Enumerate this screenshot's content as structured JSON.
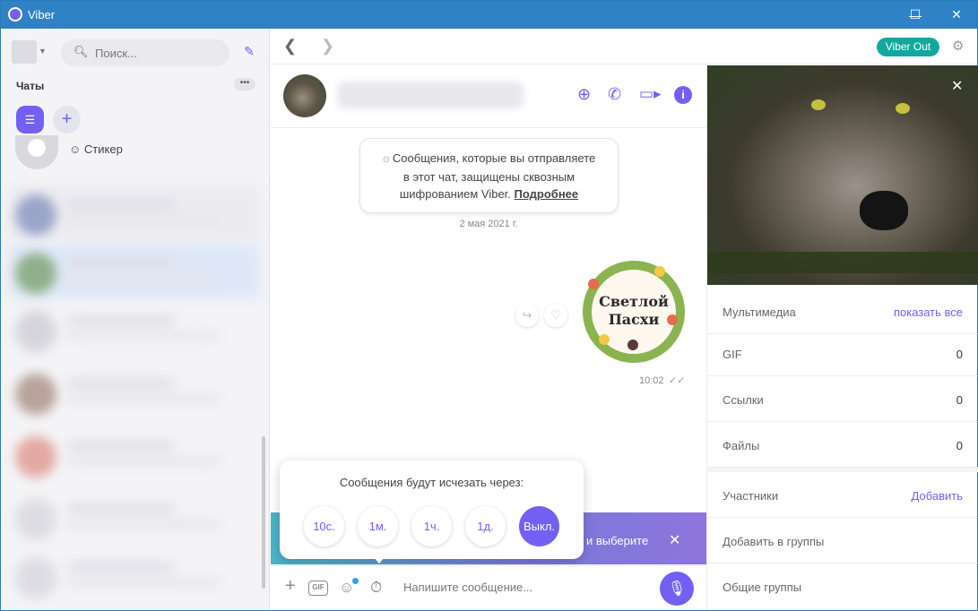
{
  "app": {
    "title": "Viber"
  },
  "window_controls": {
    "minimize": "—",
    "maximize": "☐",
    "close": "✕"
  },
  "left": {
    "search_placeholder": "Поиск...",
    "chats_label": "Чаты",
    "more": "•••",
    "sticker_row_label": "Стикер"
  },
  "topbar": {
    "viber_out": "Viber Out"
  },
  "chat": {
    "encryption_line1": "Сообщения, которые вы отправляете",
    "encryption_line2": "в этот чат, защищены сквозным",
    "encryption_line3": "шифрованием Viber.",
    "encryption_link": "Подробнее",
    "date": "2 мая 2021 г.",
    "sticker_line1": "Светлой",
    "sticker_line2": "Пасхи",
    "time": "10:02",
    "promo_text": "и выберите",
    "timer_title": "Сообщения будут исчезать через:",
    "timer_options": [
      "10с.",
      "1м.",
      "1ч.",
      "1д.",
      "Выкл."
    ],
    "timer_selected": "Выкл.",
    "composer_placeholder": "Напишите сообщение...",
    "gif_label": "GIF"
  },
  "right": {
    "rows": [
      {
        "label": "Мультимедиа",
        "link": "показать все"
      },
      {
        "label": "GIF",
        "value": "0"
      },
      {
        "label": "Ссылки",
        "value": "0"
      },
      {
        "label": "Файлы",
        "value": "0"
      }
    ],
    "members_label": "Участники",
    "members_link": "Добавить",
    "add_to_groups": "Добавить в группы",
    "common_groups": "Общие группы"
  },
  "colors": {
    "accent": "#7360f2",
    "titlebar": "#2f82c6",
    "viber_out": "#13a89e"
  }
}
